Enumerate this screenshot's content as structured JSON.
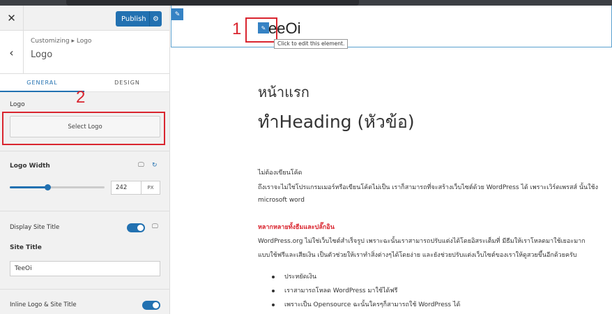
{
  "topbar": {
    "close_icon": "close-icon",
    "publish_label": "Publish",
    "publish_gear_icon": "gear-icon"
  },
  "section": {
    "back_icon": "chevron-left-icon",
    "breadcrumb": "Customizing ▸ Logo",
    "title": "Logo"
  },
  "tabs": [
    {
      "label": "GENERAL",
      "active": true
    },
    {
      "label": "DESIGN",
      "active": false
    }
  ],
  "logo": {
    "label": "Logo",
    "select_label": "Select Logo"
  },
  "logo_width": {
    "label": "Logo Width",
    "value": "242",
    "unit": "PX",
    "slider_fraction": 0.4
  },
  "display_site_title": {
    "label": "Display Site Title",
    "enabled": true
  },
  "site_title": {
    "label": "Site Title",
    "value": "TeeOi"
  },
  "inline_logo": {
    "label": "Inline Logo & Site Title",
    "enabled": true
  },
  "annotations": {
    "marker1": "1",
    "marker2": "2",
    "marker_color": "#d9252f"
  },
  "preview": {
    "site_title": "eeOi",
    "tooltip": "Click to edit this element.",
    "heading_small": "หน้าแรก",
    "heading_big": "ทำHeading (หัวข้อ)",
    "p1_line1": "ไม่ต้องเขียนโค้ด",
    "p1_line2": "ถึงเราจะไม่ใช่โปรแกรมเมอร์หรือเขียนโค้ดไม่เป็น เราก็สามารถที่จะสร้างเว็บไซต์ด้วย WordPress ได้ เพราะเวิร์ดเพรสส์ นั้นใช้ง",
    "p1_line3": "microsoft word",
    "red_heading": "หลากหลายทั้งธีมและปลั๊กอิน",
    "p2_line1": "WordPress.org ไม่ใช่เว็บไซต์สำเร็จรูป เพราะฉะนั้นเราสามารถปรับแต่งได้โดยอิสระเต็มที่ มีธีมให้เราโหลดมาใช้เยอะมาก",
    "p2_line2": "แบบใช้ฟรีและเสียเงิน เป็นตัวช่วยให้เราทำสิ่งต่างๆได้โดยง่าย และยังช่วยปรับแต่งเว็บไซต์ของเราให้ดูสวยขึ้นอีกด้วยครับ",
    "bullets": [
      "ประหยัดเงิน",
      "เราสามารถโหลด WordPress มาใช้ได้ฟรี",
      "เพราะเป็น Opensource ฉะนั้นใครๆก็สามารถใช้ WordPress ได้"
    ],
    "accent_color": "#2271b1"
  }
}
